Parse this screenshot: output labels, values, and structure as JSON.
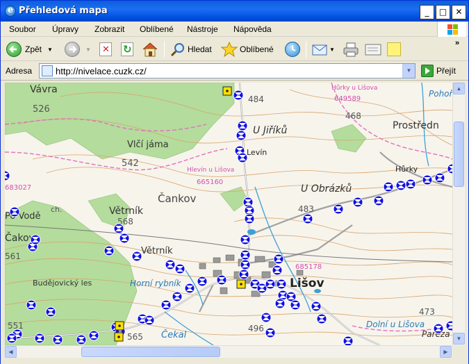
{
  "window": {
    "title": "Přehledová mapa",
    "controls": {
      "minimize": "_",
      "maximize": "□",
      "close": "✕"
    }
  },
  "menu": [
    "Soubor",
    "Úpravy",
    "Zobrazit",
    "Oblíbené",
    "Nástroje",
    "Nápověda"
  ],
  "toolbar": {
    "back_label": "Zpět",
    "search_label": "Hledat",
    "favorites_label": "Oblíbené"
  },
  "address": {
    "label": "Adresa",
    "url": "http://nivelace.cuzk.cz/",
    "go_label": "Přejít"
  },
  "map": {
    "place_labels": [
      "Vávra",
      "U Jiříků",
      "Prostředn",
      "Vlčí jáma",
      "Levín",
      "Hůrky",
      "Čankov",
      "U Obrázků",
      "Větrník",
      "Větrník",
      "Po Vodě",
      "Čakov",
      "Lišov",
      "Horní rybník",
      "Budějovický les",
      "Čekal",
      "Dolní u Lišova",
      "Pařeza",
      "Pohoř"
    ],
    "elevations": [
      "526",
      "484",
      "468",
      "542",
      "483",
      "568",
      "561",
      "473",
      "551",
      "565",
      "496"
    ],
    "benchmark_codes": [
      "649589",
      "665160",
      "683027",
      "685178"
    ],
    "small_labels": [
      "Hůrky u Lišova",
      "Hlevín u Lišova",
      "ch."
    ]
  },
  "colors": {
    "title_blue": "#0a5fd8",
    "benchmark_blue": "#1010e0",
    "forest_green": "#a8d891",
    "contour_brown": "#d9a46b",
    "water_blue": "#3aa0d8",
    "boundary_magenta": "#e070c0"
  }
}
